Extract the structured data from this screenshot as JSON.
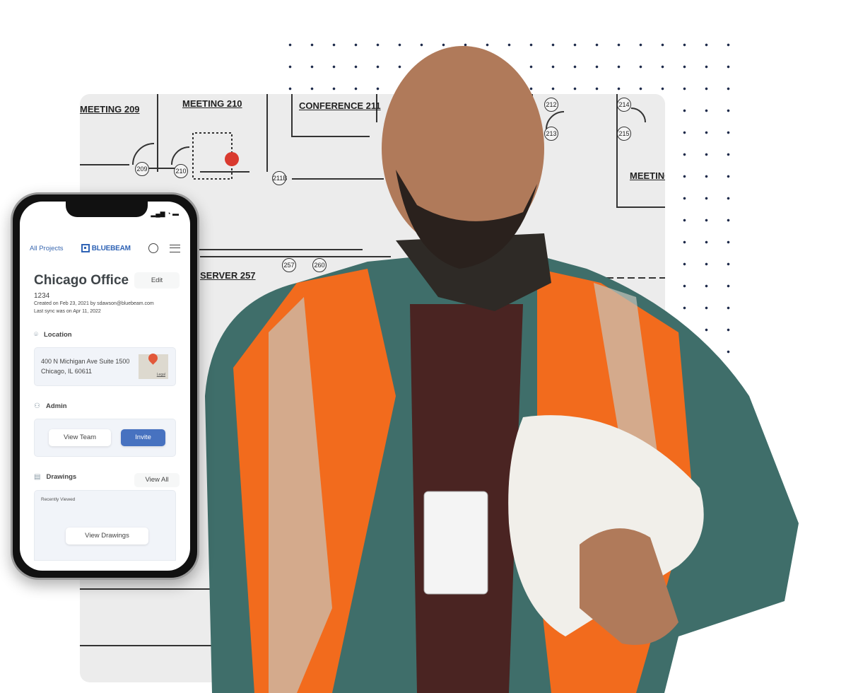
{
  "floor_plan": {
    "labels": [
      "MEETING 209",
      "MEETING 210",
      "CONFERENCE 211",
      "MEETING",
      "SERVER 257"
    ],
    "room_numbers": [
      "209",
      "210",
      "211B",
      "212",
      "213",
      "214",
      "215",
      "257",
      "260"
    ]
  },
  "phone": {
    "nav": {
      "all_projects": "All Projects",
      "logo": "BLUEBEAM",
      "profile_icon": "user-circle-icon",
      "menu_icon": "hamburger-icon"
    },
    "project": {
      "title": "Chicago Office",
      "edit_label": "Edit",
      "number": "1234",
      "created": "Created on Feb 23, 2021 by sdawson@bluebeam.com",
      "last_sync": "Last sync was on Apr 11, 2022"
    },
    "location": {
      "heading": "Location",
      "line1": "400 N Michigan Ave Suite 1500",
      "line2": "Chicago, IL 60611",
      "map_legal": "Legal"
    },
    "admin": {
      "heading": "Admin",
      "view_team": "View Team",
      "invite": "Invite"
    },
    "drawings": {
      "heading": "Drawings",
      "view_all": "View All",
      "recently_viewed": "Recently Viewed",
      "view_drawings": "View Drawings"
    }
  },
  "colors": {
    "accent": "#4772c0",
    "brand": "#2f63b5",
    "vest": "#f26b1d",
    "jacket": "#3f6e6a",
    "pin": "#e2583a"
  }
}
